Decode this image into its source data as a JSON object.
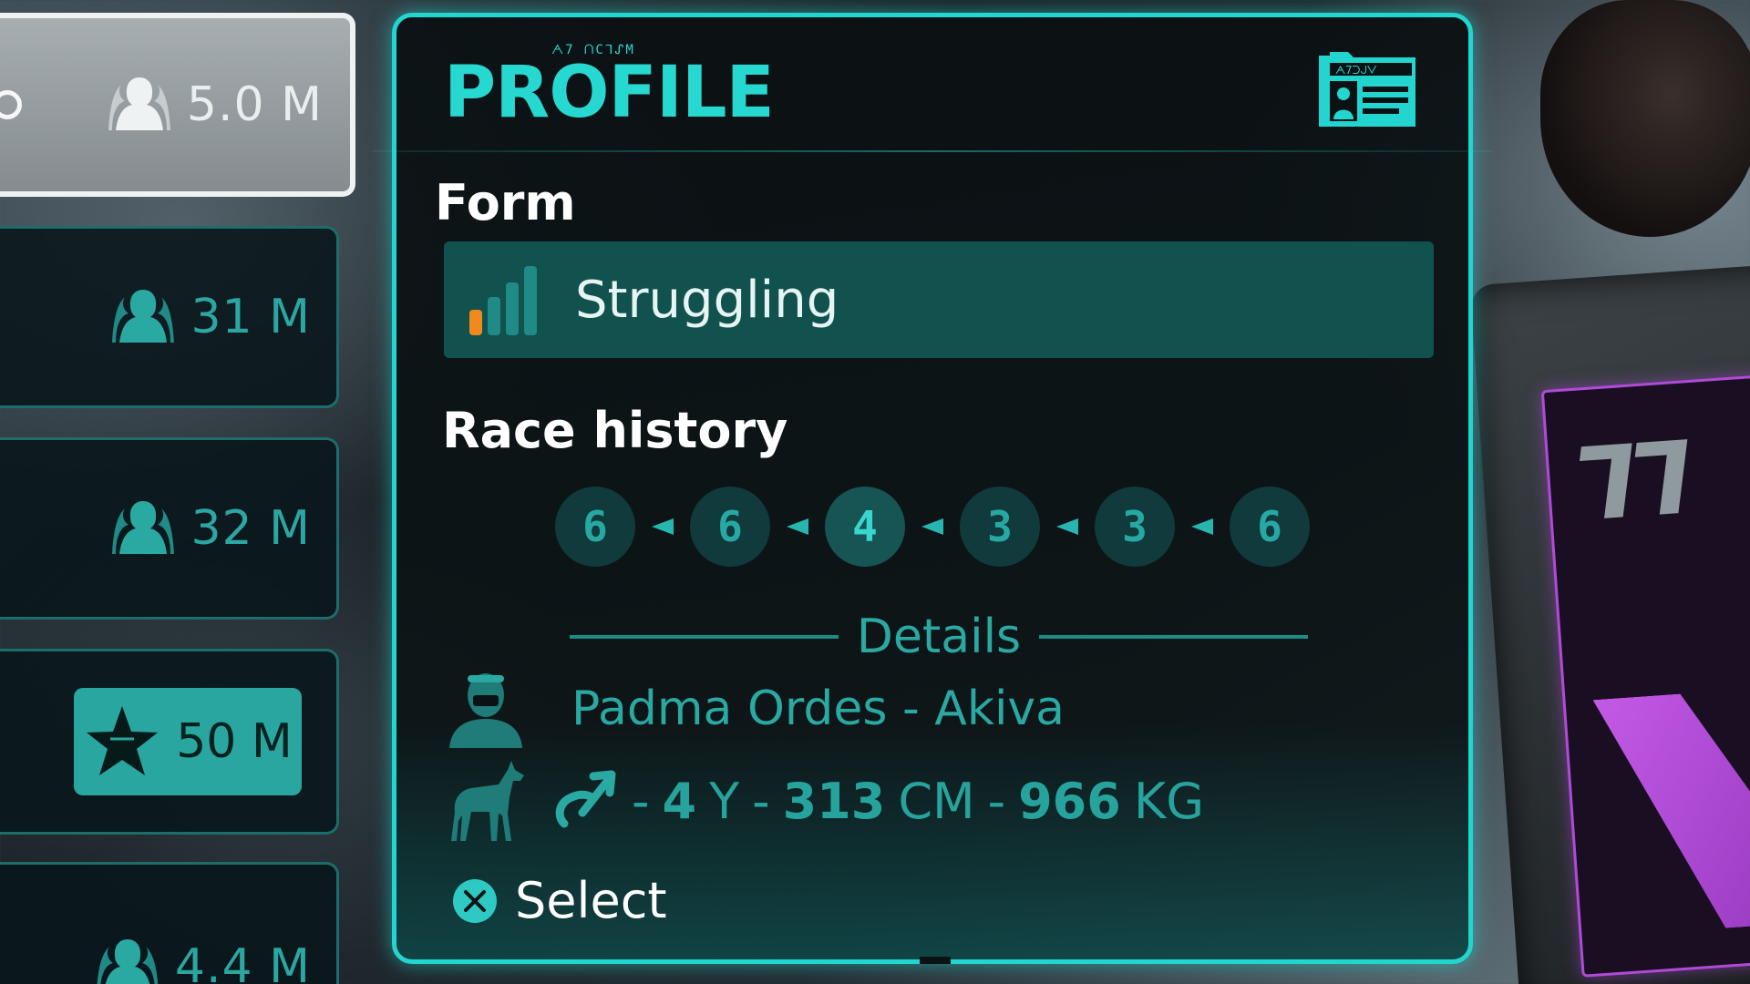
{
  "left_list": {
    "entries": [
      {
        "bet": "5.0 M",
        "selected": true,
        "favorite": false
      },
      {
        "bet": "31 M",
        "selected": false,
        "favorite": false
      },
      {
        "bet": "32 M",
        "selected": false,
        "favorite": false
      },
      {
        "bet": "50 M",
        "selected": false,
        "favorite": true
      },
      {
        "bet": "4.4 M",
        "selected": false,
        "favorite": false
      }
    ]
  },
  "profile": {
    "title": "PROFILE",
    "title_glyph": "ᗅ7 ᑎCᒣᔑM",
    "form_label": "Form",
    "form_value": "Struggling",
    "form_level": 1,
    "form_levels_total": 4,
    "race_history_label": "Race history",
    "race_history": [
      "6",
      "6",
      "4",
      "3",
      "3",
      "6"
    ],
    "details_label": "Details",
    "pilot": "Padma Ordes - Akiva",
    "stats": {
      "age_value": "4",
      "age_unit": "Y",
      "height_value": "313",
      "height_unit": "CM",
      "weight_value": "966",
      "weight_unit": "KG"
    },
    "select_label": "Select"
  },
  "colors": {
    "accent": "#22d5cf",
    "teal_text": "#2aa8a2",
    "form_bar": "#11524f",
    "form_low": "#f08a1e"
  },
  "icons": [
    "people-icon",
    "star-icon",
    "id-card-icon",
    "signal-bars-icon",
    "pilot-icon",
    "creature-icon",
    "male-symbol-icon",
    "x-button-icon"
  ]
}
